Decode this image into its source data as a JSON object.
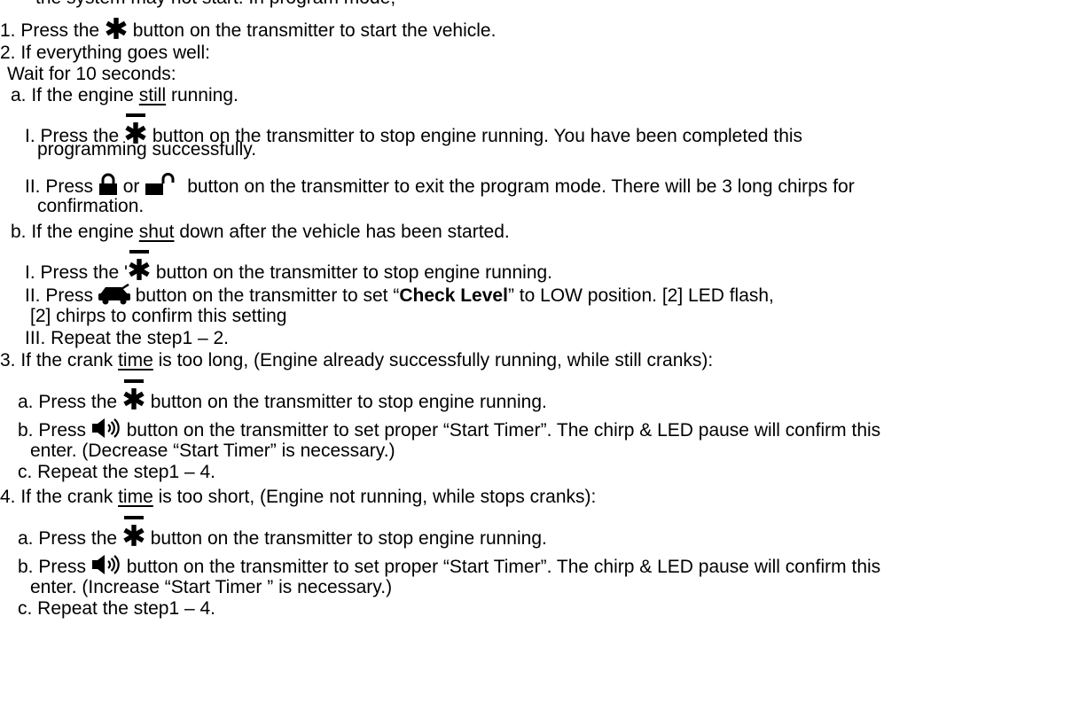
{
  "header_clipped": "    the system may not start. In program mode,",
  "steps": {
    "s1": {
      "pre": "1. Press the ",
      "post": " button on the transmitter to start the vehicle."
    },
    "s2": {
      "title": "2. If everything goes well:",
      "wait": "Wait for 10 seconds:",
      "a": {
        "pre": "a. If the engine ",
        "u": "still",
        "post": " running.",
        "i1_pre": "I. Press the ",
        "i1_post": " button on the transmitter to stop engine running. You have been completed this",
        "i1_cont": "programming successfully.",
        "ii_pre": "II. Press ",
        "ii_or": " or ",
        "ii_post": "button on the transmitter to exit the program mode. There will be 3 long chirps for",
        "ii_cont": "confirmation."
      },
      "b": {
        "pre": "b. If the engine ",
        "u": "shut",
        "post": " down after the vehicle has been started.",
        "i_pre": "I. Press the '",
        "i_post": " button on the transmitter to stop engine running.",
        "ii_pre": "II. Press ",
        "ii_mid": " button on the transmitter to set “",
        "ii_bold": "Check Level",
        "ii_post": "” to LOW position. [2] LED flash,",
        "ii_cont": "[2] chirps to confirm this setting",
        "iii": "III. Repeat the step1 – 2."
      }
    },
    "s3": {
      "pre": "3. If the crank ",
      "u": "time",
      "post": " is too long, (Engine already successfully running, while still cranks):",
      "a_pre": "a. Press the ",
      "a_post": " button on the transmitter to stop engine running.",
      "b_pre": "b. Press ",
      "b_post": " button on the transmitter to set proper “Start Timer”. The chirp & LED pause will confirm this",
      "b_cont": "enter. (Decrease “Start Timer” is necessary.)",
      "c": "c. Repeat the step1 – 4."
    },
    "s4": {
      "pre": "4. If the crank ",
      "u": "time",
      "post": " is too short, (Engine not running, while stops cranks):",
      "a_pre": "a. Press the ",
      "a_post": " button on the transmitter to stop engine running.",
      "b_pre": "b. Press ",
      "b_post": " button on the transmitter to set proper “Start Timer”. The chirp & LED pause will confirm this",
      "b_cont": "enter. (Increase “Start Timer ” is necessary.)",
      "c": "c. Repeat the step1 – 4."
    }
  },
  "icons": {
    "start": "asterisk-icon",
    "start_overbar": "asterisk-overbar-icon",
    "lock": "lock-icon",
    "unlock": "unlock-icon",
    "car": "car-icon",
    "speaker": "speaker-icon"
  }
}
